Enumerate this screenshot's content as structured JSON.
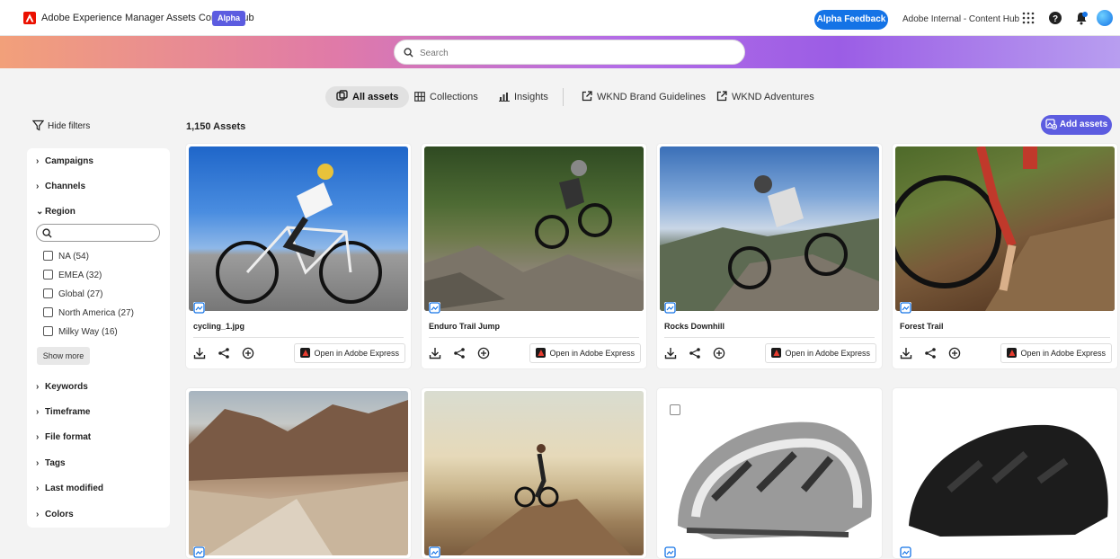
{
  "header": {
    "app_title": "Adobe Experience Manager Assets Content Hub",
    "badge": "Alpha",
    "feedback_label": "Alpha Feedback",
    "org_name": "Adobe Internal - Content Hub",
    "icons": [
      "app-switcher-icon",
      "help-icon",
      "notifications-icon",
      "avatar"
    ]
  },
  "search": {
    "placeholder": "Search"
  },
  "nav": {
    "tabs": [
      {
        "label": "All assets",
        "icon": "assets-icon",
        "active": true
      },
      {
        "label": "Collections",
        "icon": "collections-icon"
      },
      {
        "label": "Insights",
        "icon": "insights-icon"
      },
      {
        "label": "WKND Brand Guidelines",
        "icon": "external-link-icon"
      },
      {
        "label": "WKND Adventures",
        "icon": "external-link-icon"
      }
    ]
  },
  "toolbar": {
    "hide_filters": "Hide filters",
    "asset_count": "1,150 Assets",
    "add_assets": "Add assets"
  },
  "filters": {
    "sections_top": [
      "Campaigns",
      "Channels"
    ],
    "region": {
      "label": "Region",
      "options": [
        {
          "label": "NA",
          "count": "(54)"
        },
        {
          "label": "EMEA",
          "count": "(32)"
        },
        {
          "label": "Global",
          "count": "(27)"
        },
        {
          "label": "North America",
          "count": "(27)"
        },
        {
          "label": "Milky Way",
          "count": "(16)"
        }
      ],
      "show_more": "Show more"
    },
    "sections_bottom": [
      "Keywords",
      "Timeframe",
      "File format",
      "Tags",
      "Last modified",
      "Colors"
    ]
  },
  "assets": [
    {
      "title": "cycling_1.jpg",
      "action": "Open in Adobe Express"
    },
    {
      "title": "Enduro Trail Jump",
      "action": "Open in Adobe Express"
    },
    {
      "title": "Rocks Downhill",
      "action": "Open in Adobe Express"
    },
    {
      "title": "Forest Trail",
      "action": "Open in Adobe Express"
    },
    {
      "title": "",
      "action": ""
    },
    {
      "title": "",
      "action": ""
    },
    {
      "title": "",
      "action": ""
    },
    {
      "title": "",
      "action": ""
    }
  ],
  "colors": {
    "accent": "#5c5ce0",
    "feedback": "#1473e6"
  }
}
